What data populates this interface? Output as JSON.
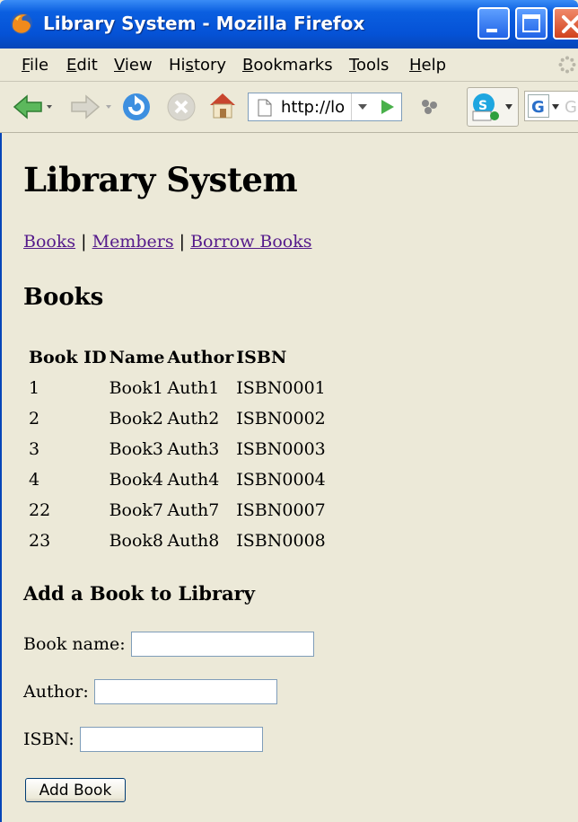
{
  "window": {
    "title": "Library System - Mozilla Firefox"
  },
  "menubar": {
    "items": [
      {
        "label": "File",
        "accel": "F"
      },
      {
        "label": "Edit",
        "accel": "E"
      },
      {
        "label": "View",
        "accel": "V"
      },
      {
        "label": "History",
        "accel": "s"
      },
      {
        "label": "Bookmarks",
        "accel": "B"
      },
      {
        "label": "Tools",
        "accel": "T"
      },
      {
        "label": "Help",
        "accel": "H"
      }
    ]
  },
  "toolbar": {
    "url": "http://lo"
  },
  "page": {
    "title": "Library System",
    "nav": {
      "books": "Books",
      "members": "Members",
      "borrow": "Borrow Books",
      "separator": "|"
    },
    "section_title": "Books",
    "table": {
      "headers": [
        "Book ID",
        "Name",
        "Author",
        "ISBN"
      ],
      "rows": [
        [
          "1",
          "Book1",
          "Auth1",
          "ISBN0001"
        ],
        [
          "2",
          "Book2",
          "Auth2",
          "ISBN0002"
        ],
        [
          "3",
          "Book3",
          "Auth3",
          "ISBN0003"
        ],
        [
          "4",
          "Book4",
          "Auth4",
          "ISBN0004"
        ],
        [
          "22",
          "Book7",
          "Auth7",
          "ISBN0007"
        ],
        [
          "23",
          "Book8",
          "Auth8",
          "ISBN0008"
        ]
      ]
    },
    "form": {
      "title": "Add a Book to Library",
      "book_name_label": "Book name:",
      "book_name_value": "",
      "author_label": "Author:",
      "author_value": "",
      "isbn_label": "ISBN:",
      "isbn_value": "",
      "submit_label": "Add Book"
    }
  }
}
